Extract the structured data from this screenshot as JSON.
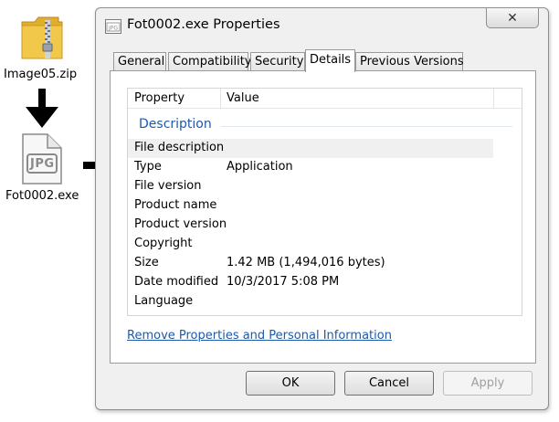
{
  "desktop": {
    "zip_label": "Image05.zip",
    "exe_label": "Fot0002.exe",
    "exe_icon_text": "JPG"
  },
  "window": {
    "title": "Fot0002.exe Properties",
    "close_glyph": "✕"
  },
  "tabs": [
    {
      "label": "General",
      "active": false
    },
    {
      "label": "Compatibility",
      "active": false
    },
    {
      "label": "Security",
      "active": false
    },
    {
      "label": "Details",
      "active": true
    },
    {
      "label": "Previous Versions",
      "active": false
    }
  ],
  "details": {
    "col_property": "Property",
    "col_value": "Value",
    "group": "Description",
    "rows": [
      {
        "property": "File description",
        "value": ""
      },
      {
        "property": "Type",
        "value": "Application"
      },
      {
        "property": "File version",
        "value": ""
      },
      {
        "property": "Product name",
        "value": ""
      },
      {
        "property": "Product version",
        "value": ""
      },
      {
        "property": "Copyright",
        "value": ""
      },
      {
        "property": "Size",
        "value": "1.42 MB (1,494,016 bytes)"
      },
      {
        "property": "Date modified",
        "value": "10/3/2017 5:08 PM"
      },
      {
        "property": "Language",
        "value": ""
      }
    ],
    "remove_link": "Remove Properties and Personal Information"
  },
  "buttons": {
    "ok": "OK",
    "cancel": "Cancel",
    "apply": "Apply"
  },
  "colors": {
    "link": "#1e5aa8",
    "zip_folder": "#f2c84b",
    "arrow": "#000000"
  },
  "icons": [
    "zip-folder-icon",
    "jpg-file-icon",
    "arrow-down-icon",
    "arrow-right-icon",
    "window-title-icon",
    "close-icon"
  ]
}
